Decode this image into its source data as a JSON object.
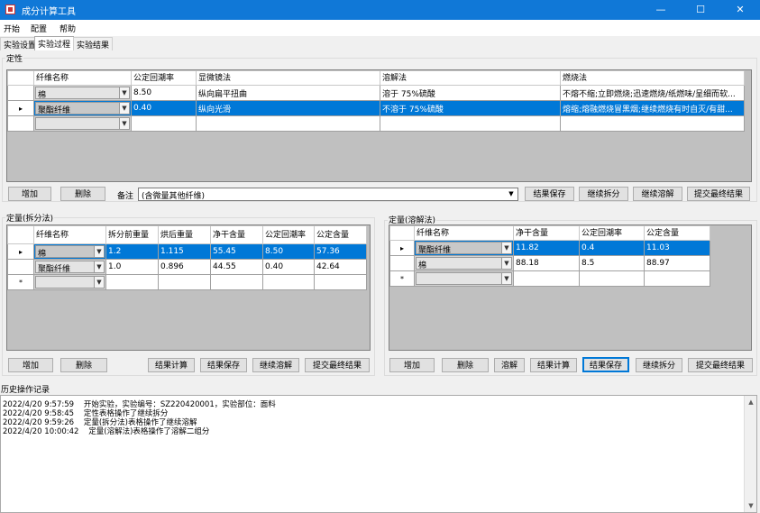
{
  "window": {
    "title": "成分计算工具",
    "minimize": "—",
    "maximize": "☐",
    "close": "✕"
  },
  "menu": [
    "开始",
    "配置",
    "帮助"
  ],
  "tabs": [
    "实验设置",
    "实验过程",
    "实验结果"
  ],
  "qualitative": {
    "group_label": "定性",
    "columns": [
      "纤维名称",
      "公定回潮率",
      "显微镜法",
      "溶解法",
      "燃烧法"
    ],
    "rows": [
      {
        "marker": "",
        "name": "棉",
        "moisture": "8.50",
        "microscope": "纵向扁平扭曲",
        "dissolve": "溶于 75%硫酸",
        "burn": "不熔不缩;立即燃烧;迅速燃烧/纸燃味/呈细而软..."
      },
      {
        "marker": "▸",
        "name": "聚酯纤维",
        "moisture": "0.40",
        "microscope": "纵向光滑",
        "dissolve": "不溶于 75%硫酸",
        "burn": "熔缩;熔融燃烧冒黑烟;继续燃烧有时自灭/有甜..."
      },
      {
        "marker": "",
        "name": "",
        "moisture": "",
        "microscope": "",
        "dissolve": "",
        "burn": ""
      }
    ],
    "add": "增加",
    "delete": "删除",
    "note_label": "备注",
    "note_value": "(含微量其他纤维)",
    "save": "结果保存",
    "continue_split": "继续拆分",
    "continue_dissolve": "继续溶解",
    "submit": "提交最终结果"
  },
  "split": {
    "group_label": "定量(拆分法)",
    "columns": [
      "纤维名称",
      "拆分前重量",
      "烘后重量",
      "净干含量",
      "公定回潮率",
      "公定含量"
    ],
    "rows": [
      {
        "marker": "▸",
        "name": "棉",
        "before": "1.2",
        "dried": "1.115",
        "net": "55.45",
        "moisture": "8.50",
        "content": "57.36"
      },
      {
        "marker": "",
        "name": "聚酯纤维",
        "before": "1.0",
        "dried": "0.896",
        "net": "44.55",
        "moisture": "0.40",
        "content": "42.64"
      },
      {
        "marker": "*",
        "name": "",
        "before": "",
        "dried": "",
        "net": "",
        "moisture": "",
        "content": ""
      }
    ],
    "add": "增加",
    "delete": "删除",
    "calc": "结果计算",
    "save": "结果保存",
    "continue_dissolve": "继续溶解",
    "submit": "提交最终结果"
  },
  "dissolve": {
    "group_label": "定量(溶解法)",
    "columns": [
      "纤维名称",
      "净干含量",
      "公定回潮率",
      "公定含量"
    ],
    "rows": [
      {
        "marker": "▸",
        "name": "聚酯纤维",
        "net": "11.82",
        "moisture": "0.4",
        "content": "11.03"
      },
      {
        "marker": "",
        "name": "棉",
        "net": "88.18",
        "moisture": "8.5",
        "content": "88.97"
      },
      {
        "marker": "*",
        "name": "",
        "net": "",
        "moisture": "",
        "content": ""
      }
    ],
    "add": "增加",
    "delete": "删除",
    "dissolve_btn": "溶解",
    "calc": "结果计算",
    "save": "结果保存",
    "continue_split": "继续拆分",
    "submit": "提交最终结果"
  },
  "history": {
    "group_label": "历史操作记录",
    "lines": [
      "2022/4/20 9:57:59    开始实验，实验编号：SZ220420001，实验部位：面料",
      "2022/4/20 9:58:45    定性表格操作了继续拆分",
      "2022/4/20 9:59:26    定量(拆分法)表格操作了继续溶解",
      "2022/4/20 10:00:42    定量(溶解法)表格操作了溶解二组分"
    ]
  }
}
